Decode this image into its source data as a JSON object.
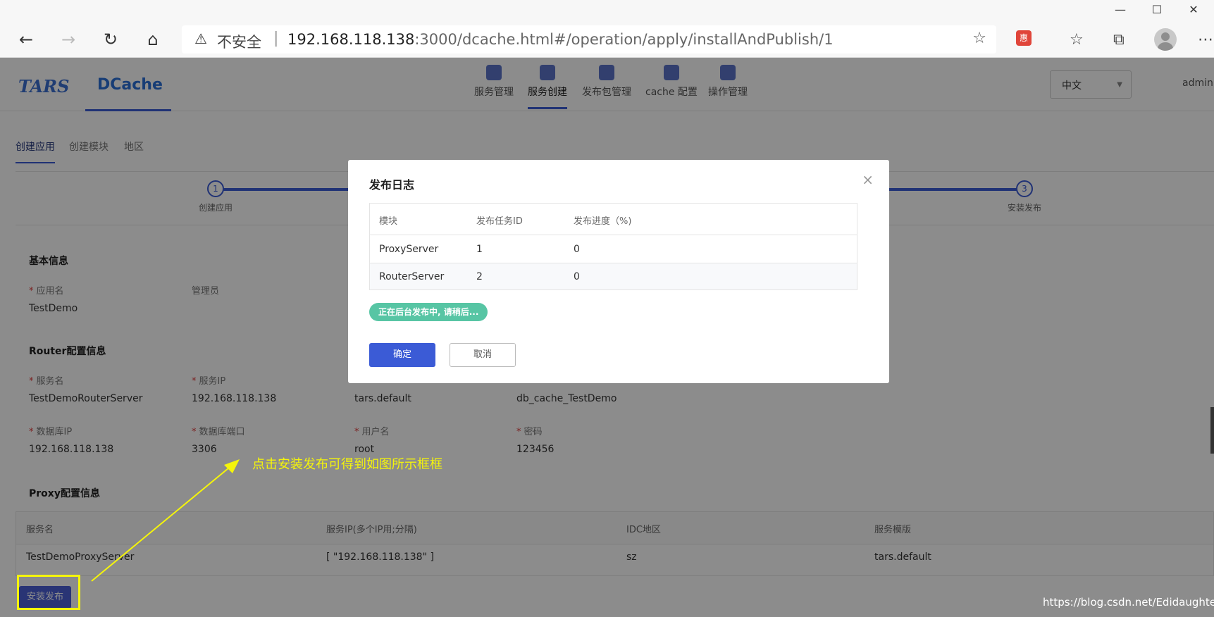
{
  "browser": {
    "insecure_label": "不安全",
    "url_host": "192.168.118.138",
    "url_rest": ":3000/dcache.html#/operation/apply/installAndPublish/1",
    "ext_badge": "惠"
  },
  "app": {
    "logo_tars": "TARS",
    "logo_dcache": "DCache",
    "nav": [
      {
        "label": "服务管理"
      },
      {
        "label": "服务创建"
      },
      {
        "label": "发布包管理"
      },
      {
        "label": "cache 配置"
      },
      {
        "label": "操作管理"
      }
    ],
    "language": "中文",
    "user": "admin",
    "subtabs": [
      "创建应用",
      "创建模块",
      "地区"
    ],
    "steps": [
      {
        "num": "1",
        "label": "创建应用"
      },
      {
        "num": "3",
        "label": "安装发布"
      }
    ],
    "basic": {
      "title": "基本信息",
      "app_name_label": "应用名",
      "admin_label": "管理员",
      "app_name": "TestDemo"
    },
    "router": {
      "title": "Router配置信息",
      "service_name_label": "服务名",
      "service_ip_label": "服务IP",
      "service_name": "TestDemoRouterServer",
      "service_ip": "192.168.118.138",
      "template": "tars.default",
      "db_name": "db_cache_TestDemo",
      "db_ip_label": "数据库IP",
      "db_port_label": "数据库端口",
      "db_user_label": "用户名",
      "db_pass_label": "密码",
      "db_ip": "192.168.118.138",
      "db_port": "3306",
      "db_user": "root",
      "db_pass": "123456"
    },
    "proxy": {
      "title": "Proxy配置信息",
      "headers": [
        "服务名",
        "服务IP(多个IP用;分隔)",
        "IDC地区",
        "服务模版"
      ],
      "row": [
        "TestDemoProxyServer",
        "[ \"192.168.118.138\" ]",
        "sz",
        "tars.default"
      ]
    },
    "install_button": "安装发布"
  },
  "modal": {
    "title": "发布日志",
    "close": "×",
    "headers": [
      "模块",
      "发布任务ID",
      "发布进度（%)"
    ],
    "rows": [
      {
        "module": "ProxyServer",
        "task_id": "1",
        "progress": "0"
      },
      {
        "module": "RouterServer",
        "task_id": "2",
        "progress": "0"
      }
    ],
    "status_pill": "正在后台发布中, 请稍后...",
    "ok_button": "确定",
    "cancel_button": "取消"
  },
  "annotation": {
    "text": "点击安装发布可得到如图所示框框",
    "color": "#f5f50a"
  },
  "watermark": "https://blog.csdn.net/Edidaughter"
}
